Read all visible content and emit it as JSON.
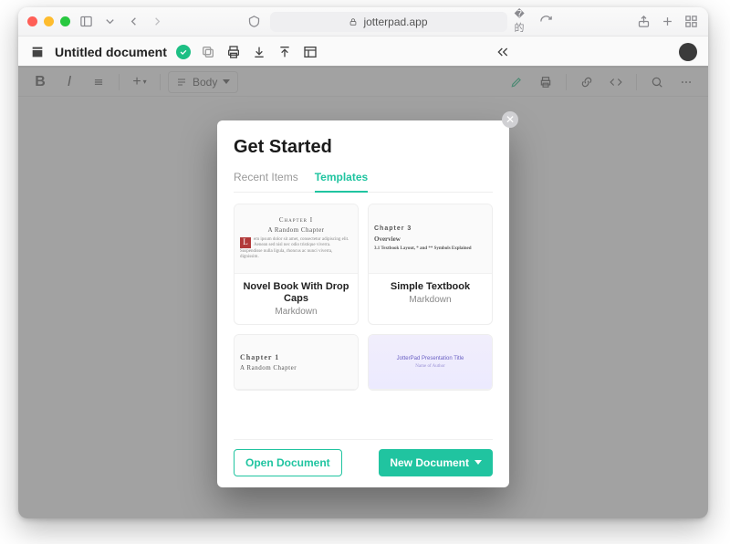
{
  "browser": {
    "address": "jotterpad.app"
  },
  "app": {
    "doc_title": "Untitled document",
    "body_style_label": "Body"
  },
  "modal": {
    "title": "Get Started",
    "tabs": {
      "recent": "Recent Items",
      "templates": "Templates",
      "active": "templates"
    },
    "cards": [
      {
        "preview": {
          "chapter": "Chapter I",
          "subtitle": "A Random Chapter",
          "body": "em ipsum dolor sit amet, consectetur adipiscing elit. Aenean sed nisl nec odio tristique viverra. Suspendisse nulla ligula, rhoncus ac nunci viverra, dignissim."
        },
        "title": "Novel Book With Drop Caps",
        "subtitle": "Markdown"
      },
      {
        "preview": {
          "chapter": "Chapter 3",
          "overview": "Overview",
          "section": "3.1  Textbook Layout, * and ** Symbols Explained"
        },
        "title": "Simple Textbook",
        "subtitle": "Markdown"
      },
      {
        "preview": {
          "chapter": "Chapter 1",
          "subtitle": "A Random Chapter"
        }
      },
      {
        "preview": {
          "pres_title": "JotterPad Presentation Title",
          "author": "Name of Author"
        }
      }
    ],
    "footer": {
      "open": "Open Document",
      "new": "New Document"
    }
  }
}
